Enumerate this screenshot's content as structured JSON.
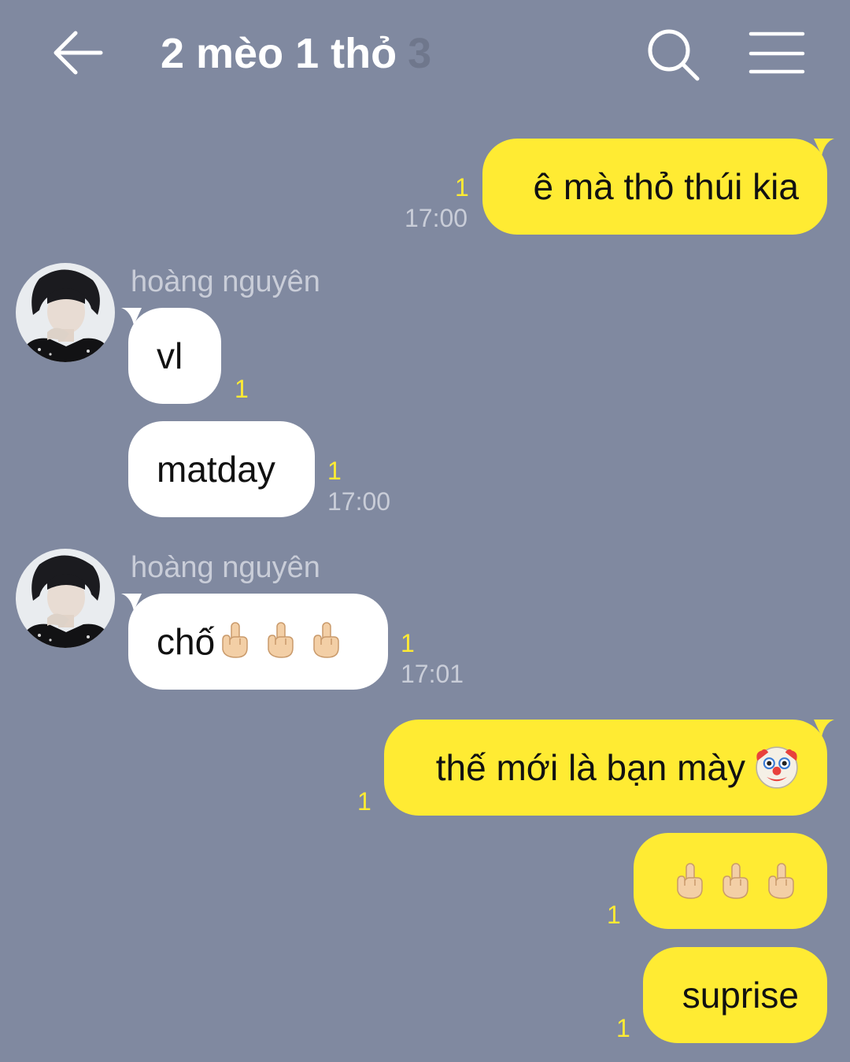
{
  "header": {
    "title": "2 mèo 1 thỏ",
    "member_count": "3",
    "back_icon": "back-arrow-icon",
    "search_icon": "search-icon",
    "menu_icon": "hamburger-menu-icon"
  },
  "colors": {
    "background": "#8089a0",
    "outgoing_bubble": "#ffeb33",
    "incoming_bubble": "#ffffff",
    "read_count": "#ffeb33",
    "meta_text": "#c9cdd8"
  },
  "messages": [
    {
      "direction": "out",
      "text": "ê mà thỏ thúi kia",
      "read_count": "1",
      "time": "17:00"
    },
    {
      "direction": "in",
      "sender": "hoàng nguyên",
      "text": "vl",
      "read_count": "1"
    },
    {
      "direction": "in",
      "text": "matday",
      "read_count": "1",
      "time": "17:00"
    },
    {
      "direction": "in",
      "sender": "hoàng nguyên",
      "text": "chố",
      "emoji": [
        "middle-finger",
        "middle-finger",
        "middle-finger"
      ],
      "read_count": "1",
      "time": "17:01"
    },
    {
      "direction": "out",
      "text": "thế mới là bạn mày",
      "emoji": [
        "clown-face"
      ],
      "read_count": "1"
    },
    {
      "direction": "out",
      "text": "",
      "emoji": [
        "middle-finger",
        "middle-finger",
        "middle-finger"
      ],
      "read_count": "1"
    },
    {
      "direction": "out",
      "text": "suprise",
      "read_count": "1"
    }
  ]
}
